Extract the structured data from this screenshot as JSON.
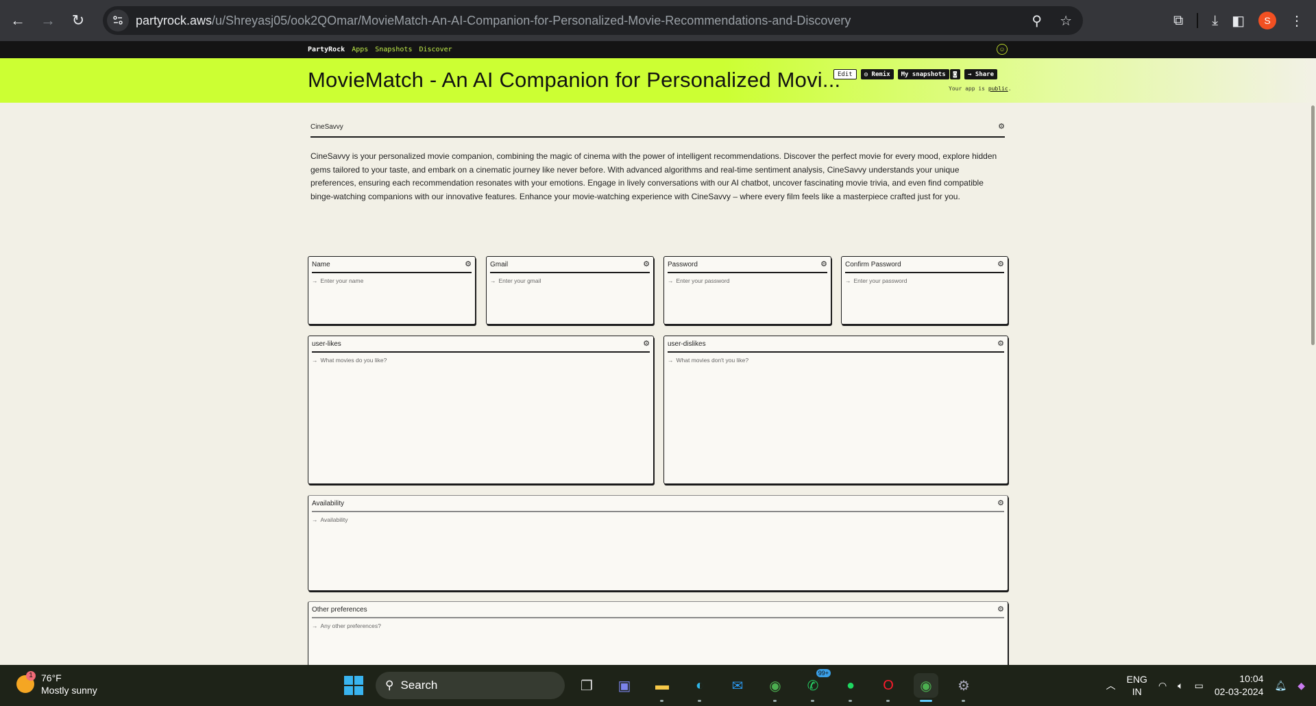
{
  "browser": {
    "url_host": "partyrock.aws",
    "url_path": "/u/Shreyasj05/ook2QOmar/MovieMatch-An-AI-Companion-for-Personalized-Movie-Recommendations-and-Discovery",
    "profile_initial": "S",
    "icons": {
      "back": "arrow-left-icon",
      "forward": "arrow-right-icon",
      "reload": "reload-icon",
      "site_info": "tune-icon",
      "zoom": "zoom-out-icon",
      "bookmark": "star-icon",
      "extensions": "puzzle-icon",
      "downloads": "download-icon",
      "side_panel": "side-panel-icon",
      "menu": "kebab-menu-icon"
    }
  },
  "partyrock_nav": {
    "brand": "PartyRock",
    "links": [
      "Apps",
      "Snapshots",
      "Discover"
    ]
  },
  "header": {
    "title": "MovieMatch - An AI Companion for Personalized Movi...",
    "actions": {
      "edit": "Edit",
      "remix": "Remix",
      "my_snapshots": "My snapshots",
      "share": "Share"
    },
    "visibility_prefix": "Your app is",
    "visibility_value": "public",
    "visibility_suffix": ".",
    "accent_color": "#ccff33"
  },
  "intro": {
    "title": "CineSavvy",
    "text": "CineSavvy is your personalized movie companion, combining the magic of cinema with the power of intelligent recommendations. Discover the perfect movie for every mood, explore hidden gems tailored to your taste, and embark on a cinematic journey like never before. With advanced algorithms and real-time sentiment analysis, CineSavvy understands your unique preferences, ensuring each recommendation resonates with your emotions. Engage in lively conversations with our AI chatbot, uncover fascinating movie trivia, and even find compatible binge-watching companions with our innovative features. Enhance your movie-watching experience with CineSavvy – where every film feels like a masterpiece crafted just for you."
  },
  "widgets": [
    {
      "title": "Name",
      "placeholder": "Enter your name"
    },
    {
      "title": "Gmail",
      "placeholder": "Enter your gmail"
    },
    {
      "title": "Password",
      "placeholder": "Enter your password"
    },
    {
      "title": "Confirm Password",
      "placeholder": "Enter your password"
    },
    {
      "title": "user-likes",
      "placeholder": "What movies do you like?"
    },
    {
      "title": "user-dislikes",
      "placeholder": "What movies don't you like?"
    },
    {
      "title": "Availability",
      "placeholder": "Availability"
    },
    {
      "title": "Other preferences",
      "placeholder": "Any other preferences?"
    }
  ],
  "taskbar": {
    "weather_temp": "76°F",
    "weather_desc": "Mostly sunny",
    "weather_badge": "1",
    "search_label": "Search",
    "whatsapp_badge": "99+",
    "language_1": "ENG",
    "language_2": "IN",
    "time": "10:04",
    "date": "02-03-2024"
  }
}
